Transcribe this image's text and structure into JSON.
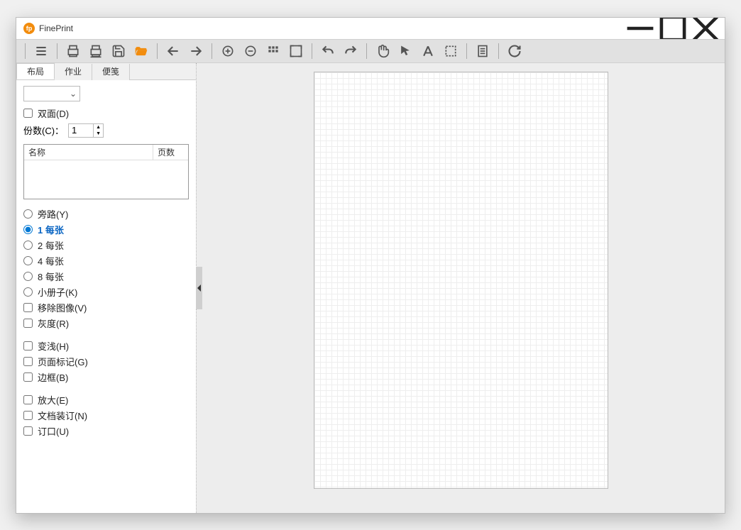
{
  "title": "FinePrint",
  "tabs": {
    "layout": "布局",
    "jobs": "作业",
    "notes": "便笺"
  },
  "panel": {
    "duplex": "双面(D)",
    "copies_label": "份数(C)：",
    "copies_value": "1",
    "doclist": {
      "name": "名称",
      "pages": "页数"
    },
    "radios": {
      "bypass": "旁路(Y)",
      "p1": "1 每张",
      "p2": "2 每张",
      "p4": "4 每张",
      "p8": "8 每张",
      "booklet": "小册子(K)"
    },
    "group2": {
      "remove_images": "移除图像(V)",
      "grayscale": "灰度(R)"
    },
    "group3": {
      "lighten": "变浅(H)",
      "page_marks": "页面标记(G)",
      "border": "边框(B)"
    },
    "group4": {
      "enlarge": "放大(E)",
      "binding": "文档装订(N)",
      "gutter": "订口(U)"
    }
  }
}
